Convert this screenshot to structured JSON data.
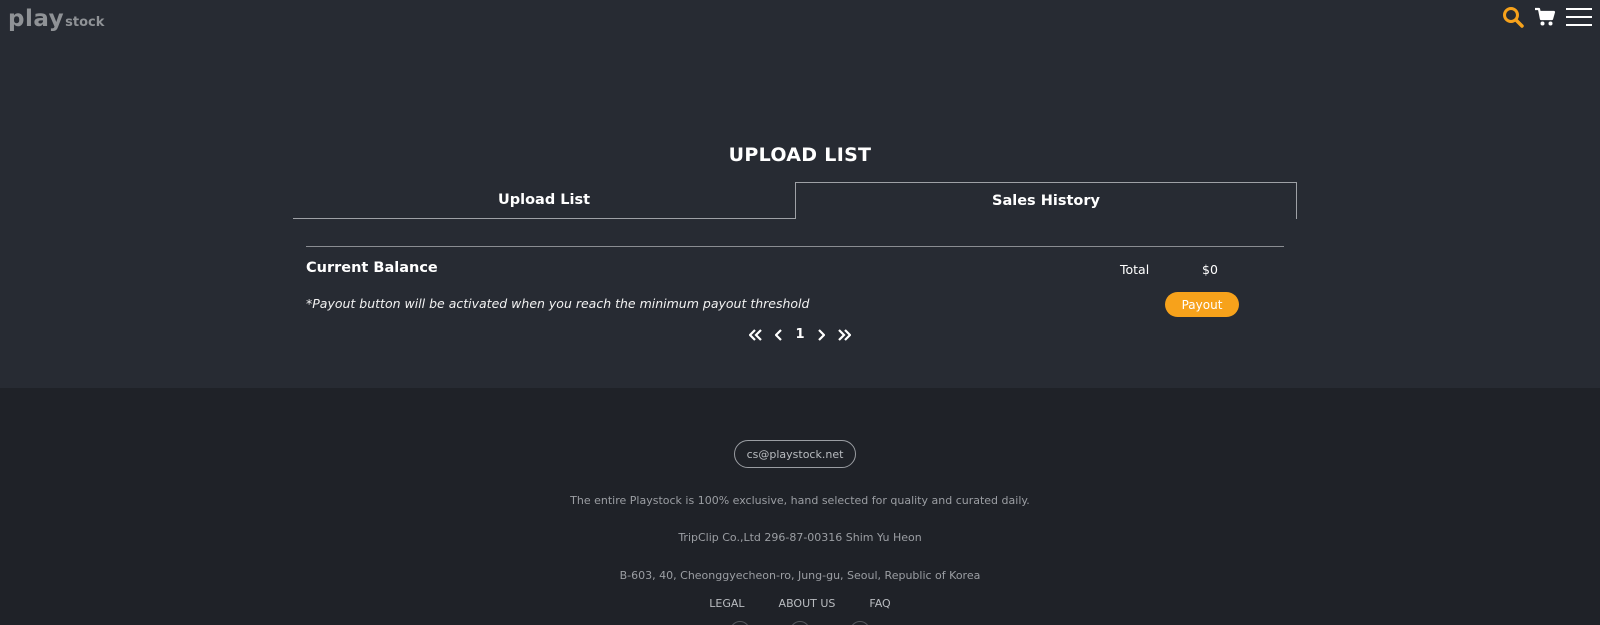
{
  "brand": {
    "logo_play": "play",
    "logo_stock": "stock"
  },
  "header": {
    "icons": [
      "search-icon",
      "cart-icon",
      "hamburger-menu-icon"
    ],
    "accent": "#f7a21b"
  },
  "page": {
    "title": "UPLOAD LIST",
    "tabs": [
      {
        "label": "Upload List",
        "active": false
      },
      {
        "label": "Sales History",
        "active": true
      }
    ]
  },
  "balance": {
    "title": "Current Balance",
    "total_label": "Total",
    "total_value": "$0",
    "note": "*Payout button will be activated when you reach the minimum payout threshold",
    "payout_label": "Payout"
  },
  "pagination": {
    "first": "«",
    "prev": "‹",
    "current": "1",
    "next": "›",
    "last": "»"
  },
  "footer": {
    "email": "cs@playstock.net",
    "tagline": "The entire Playstock is 100% exclusive, hand selected for quality and curated daily.",
    "company": "TripClip Co.,Ltd 296-87-00316 Shim Yu Heon",
    "address": "B-603, 40, Cheonggyecheon-ro, Jung-gu, Seoul, Republic of Korea",
    "links": [
      "LEGAL",
      "ABOUT US",
      "FAQ"
    ]
  },
  "colors": {
    "background": "#272b33",
    "footer_background": "#1f2228",
    "payout_button": "#f7a21b"
  }
}
